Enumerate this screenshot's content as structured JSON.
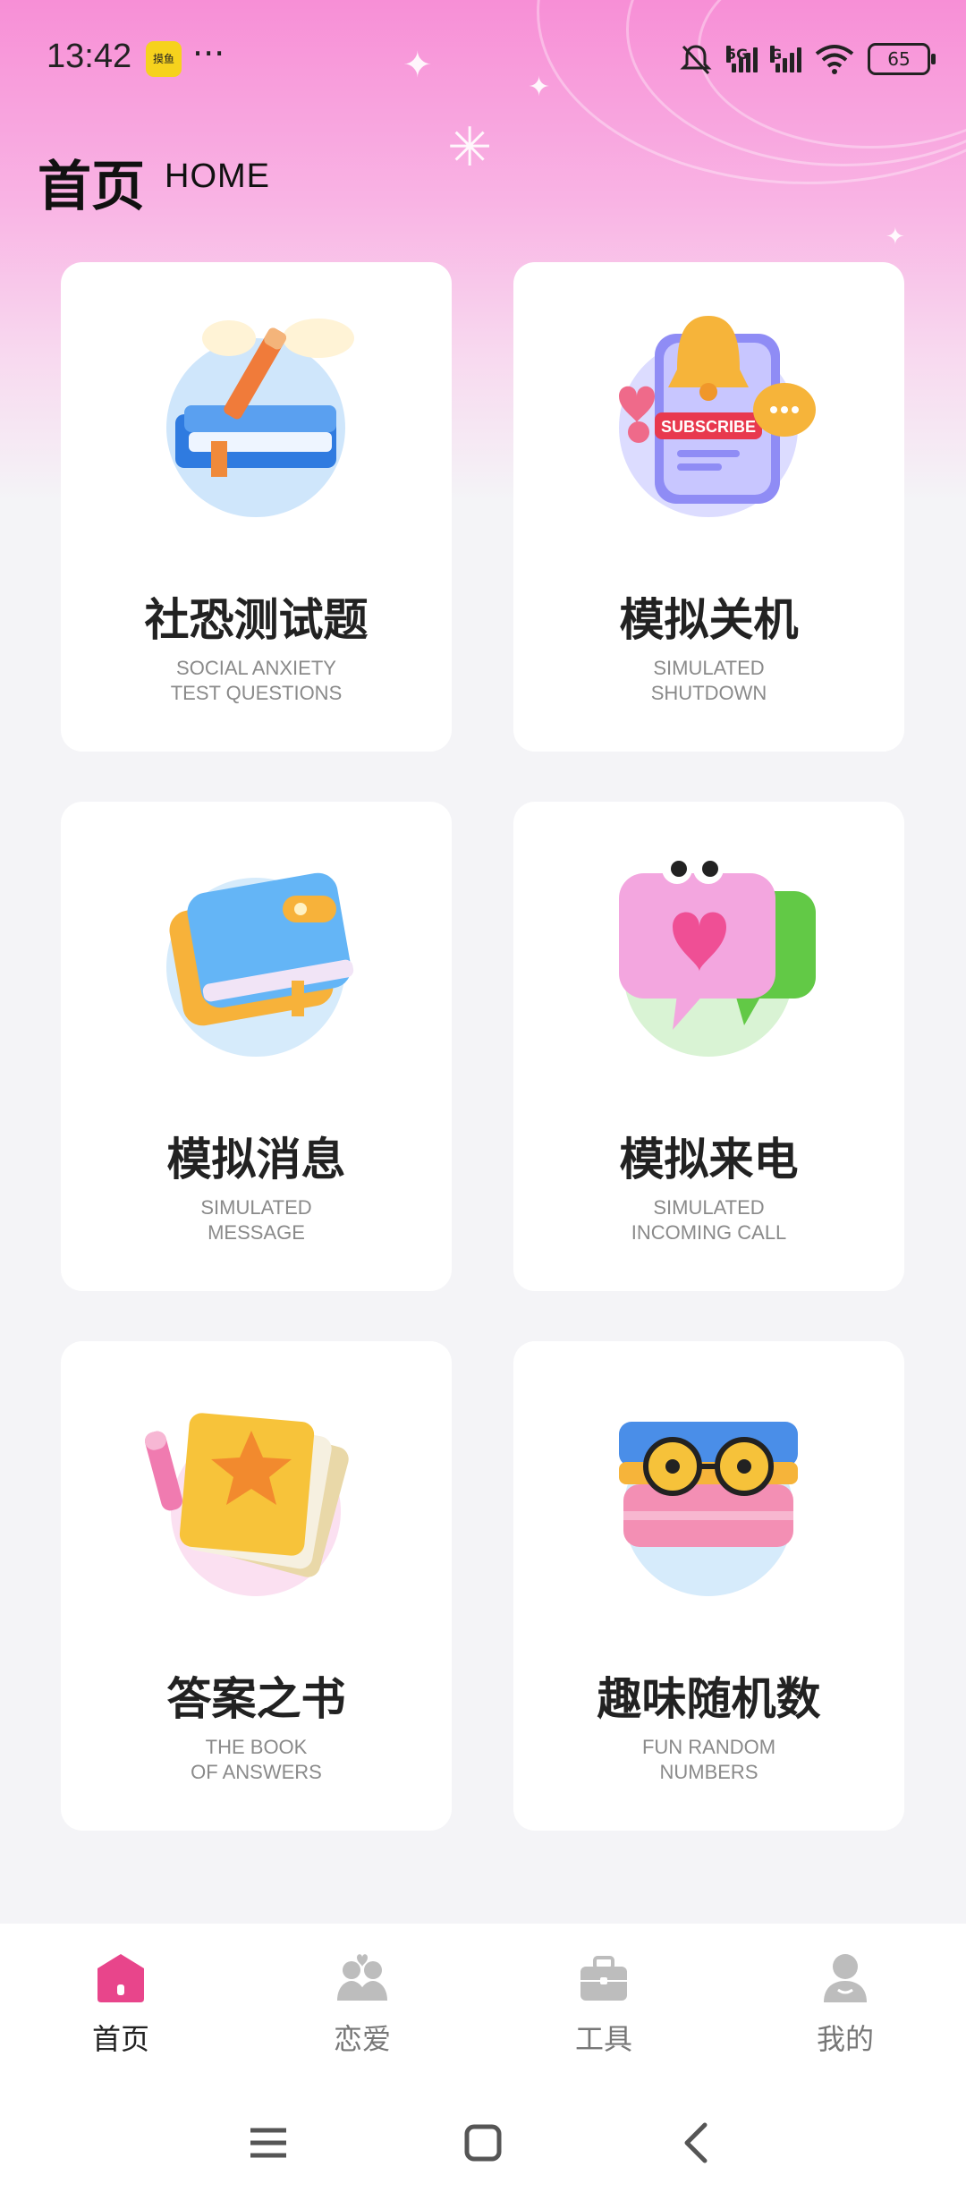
{
  "status_bar": {
    "time": "13:42",
    "app_badge": "摸鱼",
    "more": "···",
    "sig1_label": "5G",
    "sig2_label": "G",
    "battery": "65"
  },
  "header": {
    "title": "首页",
    "subtitle": "HOME"
  },
  "cards": [
    {
      "title": "社恐测试题",
      "sub1": "SOCIAL ANXIETY",
      "sub2": "TEST QUESTIONS",
      "icon": "book-pencil-icon"
    },
    {
      "title": "模拟关机",
      "sub1": "SIMULATED",
      "sub2": "SHUTDOWN",
      "icon": "subscribe-bell-icon",
      "art_text": "SUBSCRIBE"
    },
    {
      "title": "模拟消息",
      "sub1": "SIMULATED",
      "sub2": "MESSAGE",
      "icon": "notebook-icon"
    },
    {
      "title": "模拟来电",
      "sub1": "SIMULATED",
      "sub2": "INCOMING CALL",
      "icon": "chat-heart-icon"
    },
    {
      "title": "答案之书",
      "sub1": "THE BOOK",
      "sub2": "OF ANSWERS",
      "icon": "star-book-icon"
    },
    {
      "title": "趣味随机数",
      "sub1": "FUN RANDOM",
      "sub2": "NUMBERS",
      "icon": "books-glasses-icon"
    }
  ],
  "bottom_nav": [
    {
      "label": "首页",
      "active": true,
      "icon": "home-icon"
    },
    {
      "label": "恋爱",
      "active": false,
      "icon": "couple-icon"
    },
    {
      "label": "工具",
      "active": false,
      "icon": "toolbox-icon"
    },
    {
      "label": "我的",
      "active": false,
      "icon": "profile-icon"
    }
  ],
  "colors": {
    "accent": "#e8458b",
    "inactive": "#b5b5b5",
    "header_pink": "#f78fd6"
  }
}
